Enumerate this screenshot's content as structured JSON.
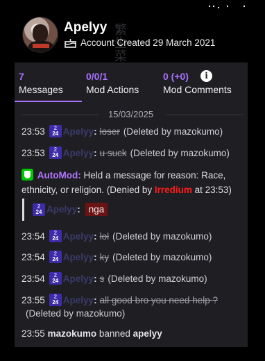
{
  "header": {
    "username": "Apelyy",
    "account_created": "Account Created 29 March 2021"
  },
  "stats": {
    "messages": {
      "value": "7",
      "label": "Messages"
    },
    "mod_actions": {
      "value": "0/0/1",
      "label": "Mod Actions"
    },
    "mod_comments": {
      "value": "0 (+0)",
      "label": "Mod Comments"
    }
  },
  "date_divider": "15/03/2025",
  "badge": {
    "top": "2",
    "bottom": "24"
  },
  "messages": [
    {
      "time": "23:53",
      "user": "Apelyy",
      "text": "loser",
      "note": "(Deleted by mazokumo)"
    },
    {
      "time": "23:53",
      "user": "Apelyy",
      "text": "u suck",
      "note": "(Deleted by mazokumo)"
    },
    {
      "time": "23:54",
      "user": "Apelyy",
      "text": "lol",
      "note": "(Deleted by mazokumo)"
    },
    {
      "time": "23:54",
      "user": "Apelyy",
      "text": "ky",
      "note": "(Deleted by mazokumo)"
    },
    {
      "time": "23:54",
      "user": "Apelyy",
      "text": "s",
      "note": "(Deleted by mazokumo)"
    },
    {
      "time": "23:55",
      "user": "Apelyy",
      "text": "all good bro you need help ?",
      "note": "(Deleted by mazokumo)"
    }
  ],
  "automod": {
    "name": "AutoMod:",
    "text1": "Held a message for reason: Race, ethnicity, or religion. (Denied by",
    "moderator": "Irredium",
    "text2": "at 23:53)",
    "held_user": "Apelyy",
    "held_text": "nga"
  },
  "system": {
    "time": "23:55",
    "moderator": "mazokumo",
    "action": "banned",
    "target": "apelyy"
  },
  "colors": {
    "accent": "#a970ff",
    "automod_name": "#b075ff",
    "moderator_red": "#ff1a1a",
    "held_bg": "#6b1313",
    "panel_bg": "#1f1f23"
  }
}
